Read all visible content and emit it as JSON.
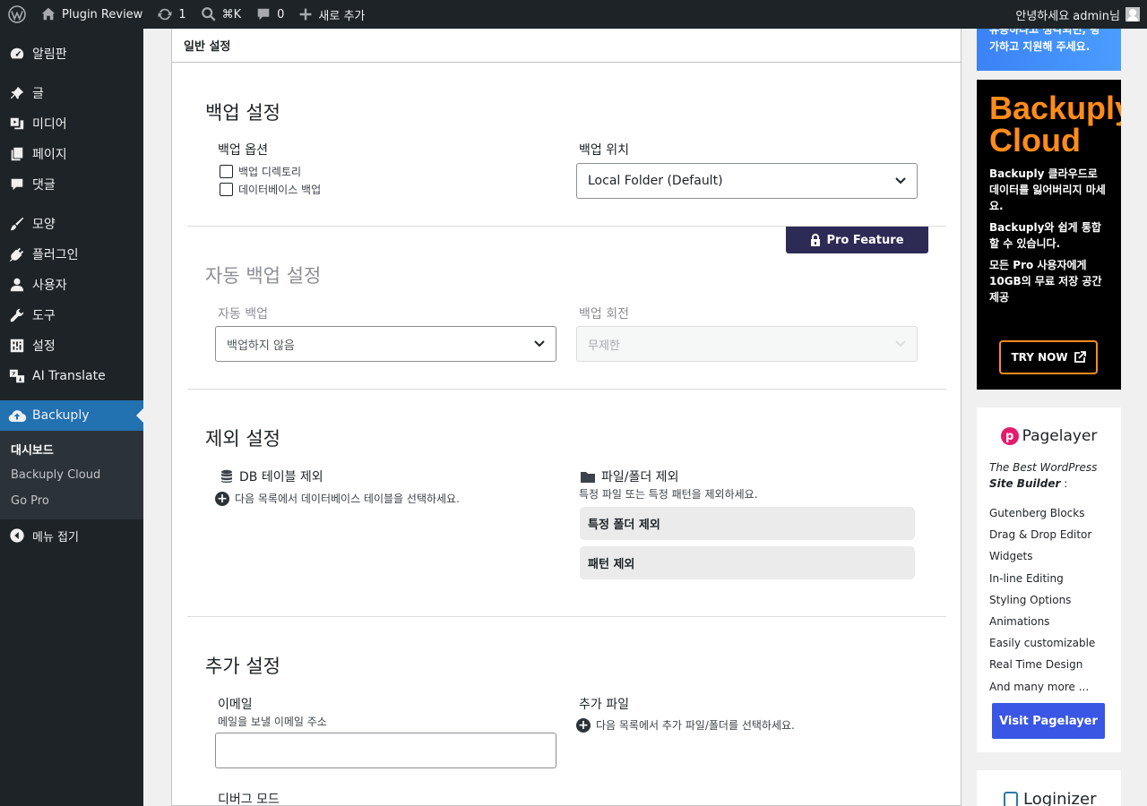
{
  "adminbar": {
    "site_name": "Plugin Review",
    "updates_count": "1",
    "search_shortcut": "⌘K",
    "comments_count": "0",
    "new_label": "새로 추가",
    "greeting": "안녕하세요 admin님"
  },
  "sidebar": {
    "items": [
      {
        "label": "알림판",
        "icon": "dashboard-icon"
      },
      {
        "label": "글",
        "icon": "pin-icon"
      },
      {
        "label": "미디어",
        "icon": "media-icon"
      },
      {
        "label": "페이지",
        "icon": "page-icon"
      },
      {
        "label": "댓글",
        "icon": "comment-icon"
      },
      {
        "label": "모양",
        "icon": "brush-icon"
      },
      {
        "label": "플러그인",
        "icon": "plugin-icon"
      },
      {
        "label": "사용자",
        "icon": "user-icon"
      },
      {
        "label": "도구",
        "icon": "wrench-icon"
      },
      {
        "label": "설정",
        "icon": "settings-icon"
      },
      {
        "label": "AI Translate",
        "icon": "translate-icon"
      },
      {
        "label": "Backuply",
        "icon": "cloud-upload-icon"
      }
    ],
    "submenu": [
      "대시보드",
      "Backuply Cloud",
      "Go Pro"
    ],
    "collapse_label": "메뉴 접기"
  },
  "main": {
    "tab_label": "일반 설정",
    "backup": {
      "title": "백업 설정",
      "options_label": "백업 옵션",
      "checkbox_dir": "백업 디렉토리",
      "checkbox_db": "데이터베이스 백업",
      "location_label": "백업 위치",
      "location_value": "Local Folder (Default)"
    },
    "auto": {
      "pro_badge": "Pro Feature",
      "title": "자동 백업 설정",
      "auto_label": "자동 백업",
      "auto_value": "백업하지 않음",
      "rotation_label": "백업 회전",
      "rotation_value": "무제한"
    },
    "exclude": {
      "title": "제외 설정",
      "db_label": "DB 테이블 제외",
      "db_hint": "다음 목록에서 데이터베이스 테이블을 선택하세요.",
      "files_label": "파일/폴더 제외",
      "files_hint": "특정 파일 또는 특정 패턴을 제외하세요.",
      "folder_btn": "특정 폴더 제외",
      "pattern_btn": "패턴 제외"
    },
    "extra": {
      "title": "추가 설정",
      "email_label": "이메일",
      "email_hint": "메일을 보낼 이메일 주소",
      "email_value": "",
      "extra_files_label": "추가 파일",
      "extra_files_hint": "다음 목록에서 추가 파일/폴더를 선택하세요.",
      "debug_label": "디버그 모드"
    }
  },
  "rail": {
    "blue_card_text_1": "유용하다고 생각되면, 평",
    "blue_card_text_2": "가하고 지원해 주세요.",
    "backuply_logo_1": "Backuply",
    "backuply_logo_2": "Cloud",
    "backuply_p1": "Backuply 클라우드로 데이터를 잃어버리지 마세요.",
    "backuply_p2": "Backuply와 쉽게 통합할 수 있습니다.",
    "backuply_p3": "모든 Pro 사용자에게 10GB의 무료 저장 공간 제공",
    "try_now": "TRY NOW",
    "pagelayer_logo": "Pagelayer",
    "pagelayer_tag_1": "The Best WordPress",
    "pagelayer_tag_2": "Site Builder",
    "pagelayer_tag_3": " :",
    "pagelayer_features": [
      "Gutenberg Blocks",
      "Drag & Drop Editor",
      "Widgets",
      "In-line Editing",
      "Styling Options",
      "Animations",
      "Easily customizable",
      "Real Time Design",
      "And many more ..."
    ],
    "pagelayer_btn": "Visit Pagelayer",
    "loginizer_logo": "Loginizer"
  },
  "colors": {
    "wp_dark": "#1d2327",
    "wp_blue": "#2271b1",
    "pro_badge": "#2d2b55",
    "backuply_orange": "#ff8c1a",
    "pagelayer_blue": "#3a56e4"
  }
}
